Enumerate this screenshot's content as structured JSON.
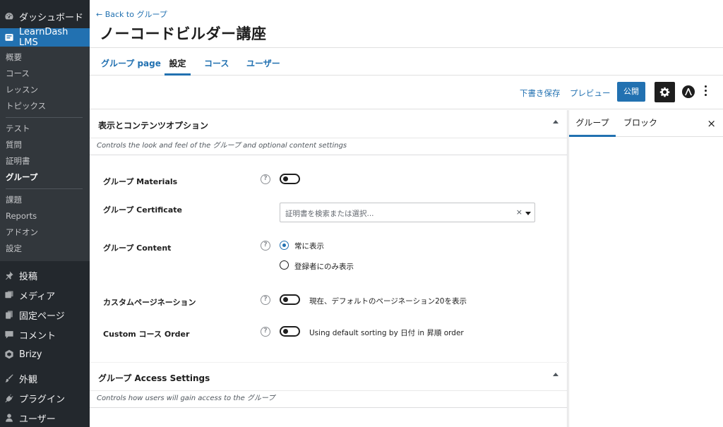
{
  "sidebar": {
    "dashboard": "ダッシュボード",
    "learndash": "LearnDash LMS",
    "submenu": [
      "概要",
      "コース",
      "レッスン",
      "トピックス",
      "テスト",
      "質問",
      "証明書",
      "グループ",
      "課題",
      "Reports",
      "アドオン",
      "設定"
    ],
    "menu": [
      "投稿",
      "メディア",
      "固定ページ",
      "コメント",
      "Brizy",
      "外観",
      "プラグイン",
      "ユーザー"
    ]
  },
  "header": {
    "back_link": "← Back to グループ",
    "title": "ノーコードビルダー講座"
  },
  "tabs": [
    "グループ page",
    "設定",
    "コース",
    "ユーザー"
  ],
  "toolbar": {
    "save_draft": "下書き保存",
    "preview": "プレビュー",
    "publish": "公開"
  },
  "panel_display": {
    "title": "表示とコンテンツオプション",
    "description": "Controls the look and feel of the グループ and optional content settings",
    "materials_label": "グループ Materials",
    "certificate_label": "グループ Certificate",
    "certificate_placeholder": "証明書を検索または選択...",
    "certificate_clear": "×",
    "content_label": "グループ Content",
    "content_options": [
      "常に表示",
      "登録者にのみ表示"
    ],
    "pagination_label": "カスタムページネーション",
    "pagination_text": "現在、デフォルトのページネーション20を表示",
    "order_label": "Custom コース Order",
    "order_text": "Using default sorting by 日付 in 昇順 order"
  },
  "panel_access": {
    "title": "グループ Access Settings",
    "description": "Controls how users will gain access to the グループ"
  },
  "inspector": {
    "tabs": [
      "グループ",
      "ブロック"
    ],
    "close": "×"
  },
  "help_glyph": "?",
  "colors": {
    "sidebar_bg": "#23282d",
    "accent": "#2271b1",
    "dark": "#1e1e1e"
  }
}
